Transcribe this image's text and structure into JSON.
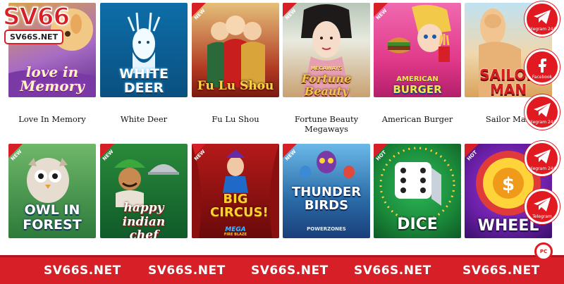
{
  "brand": {
    "name": "SV66",
    "url": "SV66S.NET"
  },
  "row1": [
    {
      "title": "Love In Memory",
      "art": "love in Memory"
    },
    {
      "title": "White Deer",
      "art": "WHITE DEER"
    },
    {
      "title": "Fu Lu Shou",
      "art": "Fu Lu Shou",
      "badge": "NEW"
    },
    {
      "title": "Fortune Beauty Megaways",
      "art": "Fortune Beauty",
      "art_top": "MEGAWAYS",
      "badge": "NEW"
    },
    {
      "title": "American Burger",
      "art": "BURGER",
      "art_top": "AMERICAN",
      "badge": "NEW"
    },
    {
      "title": "Sailor Man",
      "art": "SAILOR MAN"
    }
  ],
  "row2": [
    {
      "art": "OWL IN FOREST",
      "badge": "NEW"
    },
    {
      "art": "happy indian chef",
      "badge": "NEW"
    },
    {
      "art": "BIG CIRCUS!",
      "art_sub": "MEGA",
      "art_sub2": "FIRE BLAZE",
      "badge": "NEW"
    },
    {
      "art": "THUNDER BIRDS",
      "art_sub": "POWERZONES",
      "badge": "NEW"
    },
    {
      "art": "DICE",
      "badge": "HOT"
    },
    {
      "art": "WHEEL",
      "badge": "HOT"
    }
  ],
  "social": [
    {
      "icon": "telegram-icon",
      "label": "Telegram 24/7"
    },
    {
      "icon": "facebook-icon",
      "label": "Facebook"
    },
    {
      "icon": "telegram-icon",
      "label": "Telegram 24/7"
    },
    {
      "icon": "telegram-icon",
      "label": "Telegram 24/7"
    },
    {
      "icon": "telegram-icon",
      "label": "Telegram"
    }
  ],
  "mini_label": "PC",
  "footer": [
    "SV66S.NET",
    "SV66S.NET",
    "SV66S.NET",
    "SV66S.NET",
    "SV66S.NET"
  ],
  "colors": {
    "accent": "#d61f26",
    "social": "#e11a22"
  }
}
